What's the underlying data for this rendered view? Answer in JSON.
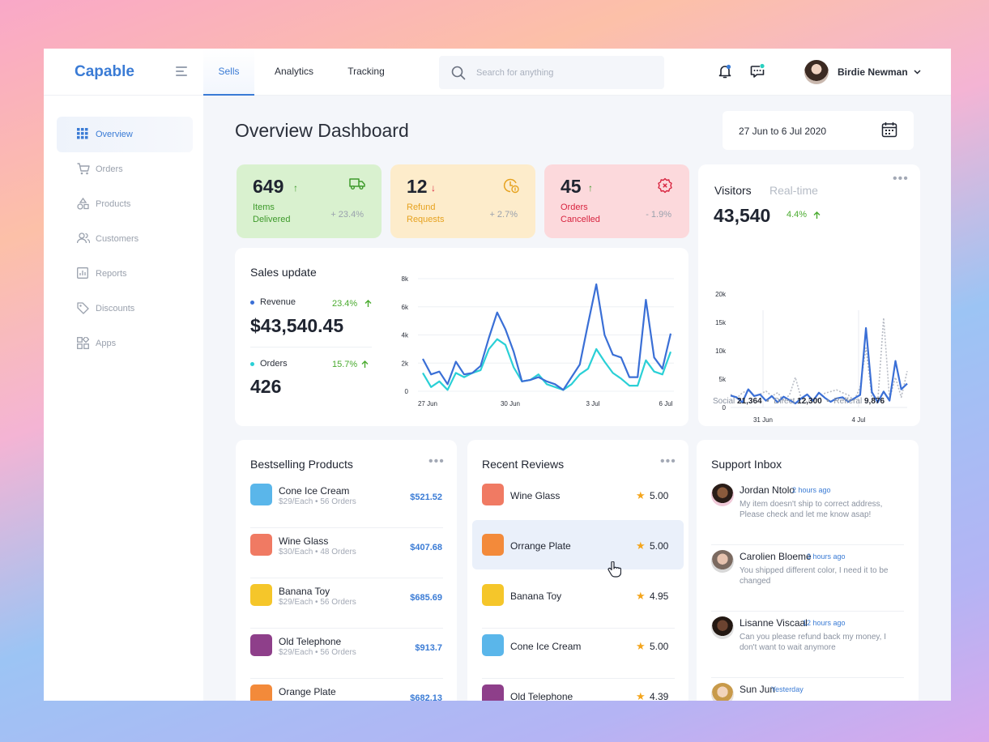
{
  "app": {
    "name": "Capable"
  },
  "nav_tabs": [
    {
      "label": "Sells",
      "active": true
    },
    {
      "label": "Analytics",
      "active": false
    },
    {
      "label": "Tracking",
      "active": false
    }
  ],
  "search": {
    "placeholder": "Search for anything"
  },
  "user": {
    "name": "Birdie Newman"
  },
  "sidebar": {
    "items": [
      {
        "label": "Overview",
        "icon": "grid-icon",
        "active": true
      },
      {
        "label": "Orders",
        "icon": "cart-icon",
        "active": false
      },
      {
        "label": "Products",
        "icon": "shapes-icon",
        "active": false
      },
      {
        "label": "Customers",
        "icon": "users-icon",
        "active": false
      },
      {
        "label": "Reports",
        "icon": "report-icon",
        "active": false
      },
      {
        "label": "Discounts",
        "icon": "tag-icon",
        "active": false
      },
      {
        "label": "Apps",
        "icon": "apps-icon",
        "active": false
      }
    ]
  },
  "page": {
    "title": "Overview Dashboard",
    "date_range": "27 Jun to 6 Jul 2020"
  },
  "stats": [
    {
      "value": "649",
      "arrow": "↑",
      "label": "Items Delivered",
      "change": "+ 23.4%",
      "icon": "truck-icon",
      "color": "#d9f1cf"
    },
    {
      "value": "12",
      "arrow": "↓",
      "label": "Refund Requests",
      "change": "+ 2.7%",
      "icon": "refund-icon",
      "color": "#fdeccb"
    },
    {
      "value": "45",
      "arrow": "↑",
      "label": "Orders Cancelled",
      "change": "- 1.9%",
      "icon": "cancel-gear-icon",
      "color": "#fcd9dc"
    }
  ],
  "sales": {
    "title": "Sales update",
    "revenue_label": "Revenue",
    "revenue_value": "$43,540.45",
    "revenue_growth": "23.4%",
    "orders_label": "Orders",
    "orders_value": "426",
    "orders_growth": "15.7%"
  },
  "visitors": {
    "tab_active": "Visitors",
    "tab_other": "Real-time",
    "value": "43,540",
    "growth": "4.4%",
    "social_label": "Social",
    "social_value": "21,364",
    "direct_label": "Direct",
    "direct_value": "12,300",
    "referral_label": "Refferal",
    "referral_value": "9,876"
  },
  "chart_data": [
    {
      "type": "line",
      "title": "",
      "x": [
        "27 Jun",
        "",
        "",
        "",
        "",
        "",
        "",
        "",
        "",
        "",
        "30 Jun",
        "",
        "",
        "",
        "",
        "",
        "",
        "",
        "",
        "",
        "3 Jul",
        "",
        "",
        "",
        "",
        "",
        "",
        "",
        "",
        "",
        "6 Jul"
      ],
      "xticks": [
        "27 Jun",
        "30 Jun",
        "3 Jul",
        "6 Jul"
      ],
      "yticks": [
        "0",
        "2k",
        "4k",
        "6k",
        "8k"
      ],
      "ylim": [
        0,
        8000
      ],
      "series": [
        {
          "name": "Revenue",
          "color": "#3a6fd6",
          "values": [
            2300,
            1200,
            1400,
            500,
            2100,
            1200,
            1300,
            1800,
            3800,
            5600,
            4400,
            2800,
            700,
            800,
            1000,
            700,
            500,
            100,
            1000,
            1900,
            4800,
            7600,
            4000,
            2600,
            2400,
            1000,
            1000,
            6500,
            2400,
            1600,
            4100
          ]
        },
        {
          "name": "Orders",
          "color": "#2ad0d6",
          "values": [
            1300,
            300,
            700,
            100,
            1300,
            1000,
            1300,
            1500,
            3000,
            3700,
            3300,
            1700,
            700,
            800,
            1200,
            500,
            300,
            100,
            500,
            1200,
            1600,
            3000,
            2100,
            1300,
            900,
            400,
            400,
            2200,
            1400,
            1200,
            2800
          ]
        }
      ]
    },
    {
      "type": "line",
      "title": "",
      "xticks": [
        "31 Jun",
        "4 Jul"
      ],
      "yticks": [
        "0",
        "5k",
        "10k",
        "15k",
        "20k"
      ],
      "ylim": [
        0,
        20000
      ],
      "series": [
        {
          "name": "",
          "style": "solid",
          "color": "#3a6fd6",
          "values": [
            2100,
            1800,
            900,
            3200,
            2000,
            2300,
            1200,
            2000,
            900,
            1900,
            1300,
            700,
            1600,
            2300,
            1200,
            2600,
            1700,
            1000,
            1600,
            1800,
            1000,
            1600,
            2200,
            14000,
            2700,
            900,
            2800,
            1200,
            8200,
            3200,
            4200
          ]
        },
        {
          "name": "",
          "style": "dotted",
          "color": "#b8bcc5",
          "values": [
            2300,
            1600,
            2600,
            3000,
            2100,
            2300,
            2900,
            2000,
            2600,
            1300,
            2200,
            5300,
            1600,
            900,
            1700,
            1400,
            2500,
            2800,
            3100,
            2600,
            2200,
            1200,
            3600,
            10500,
            1800,
            1100,
            15800,
            1500,
            5300,
            1800,
            6400
          ]
        }
      ]
    }
  ],
  "bestselling": {
    "title": "Bestselling Products",
    "items": [
      {
        "name": "Cone Ice Cream",
        "meta": "$29/Each • 56 Orders",
        "price": "$521.52",
        "color": "#5ab6ea"
      },
      {
        "name": "Wine Glass",
        "meta": "$30/Each • 48 Orders",
        "price": "$407.68",
        "color": "#f07a63"
      },
      {
        "name": "Banana Toy",
        "meta": "$29/Each • 56 Orders",
        "price": "$685.69",
        "color": "#f5c62a"
      },
      {
        "name": "Old Telephone",
        "meta": "$29/Each • 56 Orders",
        "price": "$913.7",
        "color": "#8e3f8a"
      },
      {
        "name": "Orange Plate",
        "meta": "",
        "price": "$682.13",
        "color": "#f38a3a"
      }
    ]
  },
  "reviews": {
    "title": "Recent Reviews",
    "items": [
      {
        "name": "Wine Glass",
        "rating": "5.00",
        "color": "#f07a63"
      },
      {
        "name": "Orrange Plate",
        "rating": "5.00",
        "color": "#f38a3a"
      },
      {
        "name": "Banana Toy",
        "rating": "4.95",
        "color": "#f5c62a"
      },
      {
        "name": "Cone Ice Cream",
        "rating": "5.00",
        "color": "#5ab6ea"
      },
      {
        "name": "Old Telephone",
        "rating": "4.39",
        "color": "#8e3f8a"
      }
    ]
  },
  "inbox": {
    "title": "Support Inbox",
    "messages": [
      {
        "name": "Jordan Ntolo",
        "time": "2 hours ago",
        "text": "My item doesn't ship to correct address, Please check and let me know asap!"
      },
      {
        "name": "Carolien Bloeme",
        "time": "3 hours ago",
        "text": "You shipped different color, I need it to be changed"
      },
      {
        "name": "Lisanne Viscaal",
        "time": "12 hours ago",
        "text": "Can you please refund back my money, I don't want to wait anymore"
      },
      {
        "name": "Sun Jun",
        "time": "Yesterday",
        "text": ""
      }
    ]
  }
}
